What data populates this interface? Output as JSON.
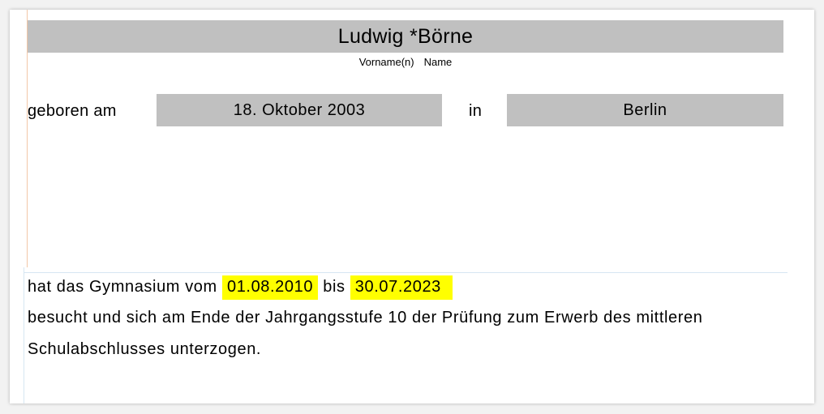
{
  "header": {
    "full_name": "Ludwig *Börne",
    "caption_first": "Vorname(n)",
    "caption_last": "Name"
  },
  "birth": {
    "label": "geboren am",
    "date": "18. Oktober 2003",
    "in_label": "in",
    "place": "Berlin"
  },
  "statement": {
    "line1_prefix": "hat das Gymnasium vom",
    "from_date": "01.08.2010",
    "between": "bis",
    "to_date": "30.07.2023",
    "line2": "besucht und sich am Ende der Jahrgangsstufe 10 der Prüfung zum Erwerb des mittleren",
    "line3": "Schulabschlusses unterzogen."
  },
  "colors": {
    "field_grey": "#c0c0c0",
    "highlight": "#ffff00"
  }
}
